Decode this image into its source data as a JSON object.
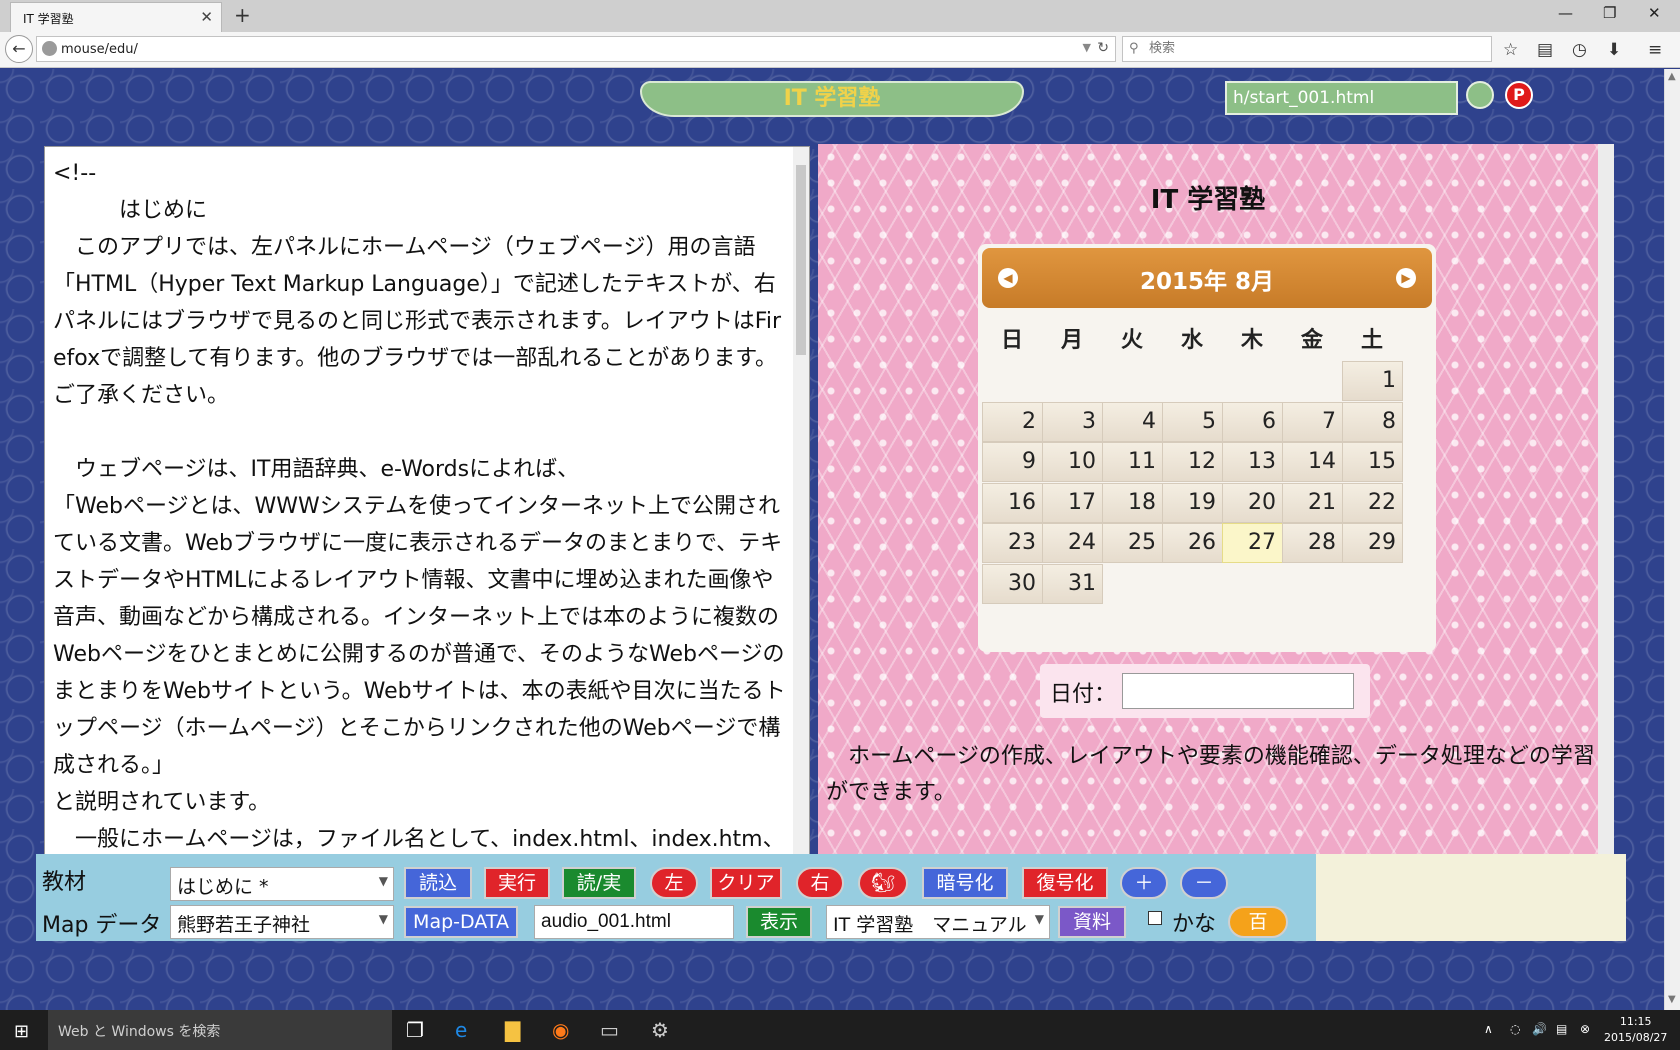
{
  "browser": {
    "tab_title": "IT 学習塾",
    "url": "mouse/edu/",
    "search_placeholder": "検索"
  },
  "header": {
    "title": "IT 学習塾",
    "file_value": "h/start_001.html",
    "p_button": "P"
  },
  "left_panel": {
    "text": "<!--\n　　　はじめに\n　このアプリでは、左パネルにホームページ（ウェブページ）用の言語「HTML（Hyper Text Markup Language）」で記述したテキストが、右パネルにはブラウザで見るのと同じ形式で表示されます。レイアウトはFirefoxで調整して有ります。他のブラウザでは一部乱れることがあります。ご了承ください。\n\n　ウェブページは、IT用語辞典、e-Wordsによれば、\n「Webページとは、WWWシステムを使ってインターネット上で公開されている文書。Webブラウザに一度に表示されるデータのまとまりで、テキストデータやHTMLによるレイアウト情報、文書中に埋め込まれた画像や音声、動画などから構成される。インターネット上では本のように複数のWebページをひとまとめに公開するのが普通で、そのようなWebページのまとまりをWebサイトという。Webサイトは、本の表紙や目次に当たるトップページ（ホームページ）とそこからリンクされた他のWebページで構成される。」\nと説明されています。\n　一般にホームページは，ファイル名として、index.html、index.htm、default.html などが用いられています。なお、本アプ"
  },
  "right_panel": {
    "title": "IT 学習塾",
    "calendar": {
      "title": "2015年 8月",
      "prev_icon": "prev-arrow",
      "next_icon": "next-arrow",
      "weekdays": [
        "日",
        "月",
        "火",
        "水",
        "木",
        "金",
        "土"
      ],
      "first_weekday_index": 6,
      "days": [
        "1",
        "2",
        "3",
        "4",
        "5",
        "6",
        "7",
        "8",
        "9",
        "10",
        "11",
        "12",
        "13",
        "14",
        "15",
        "16",
        "17",
        "18",
        "19",
        "20",
        "21",
        "22",
        "23",
        "24",
        "25",
        "26",
        "27",
        "28",
        "29",
        "30",
        "31"
      ],
      "today": "27"
    },
    "date_label": "日付：",
    "date_value": "",
    "description": "　ホームページの作成、レイアウトや要素の機能確認、データ処理などの学習ができます。"
  },
  "controls": {
    "row1": {
      "label": "教材",
      "select_value": "はじめに *",
      "buttons": {
        "load": "読込",
        "run": "実行",
        "load_run": "読/実",
        "left": "左",
        "clear": "クリア",
        "right": "右",
        "squirrel_icon": "squirrel-icon",
        "encrypt": "暗号化",
        "decrypt": "復号化",
        "plus": "＋",
        "minus": "－"
      }
    },
    "row2": {
      "label": "Map データ",
      "select_value": "熊野若王子神社",
      "map_data_button": "Map-DATA",
      "file_value": "audio_001.html",
      "show_button": "表示",
      "manual_select": "IT 学習塾　マニュアル",
      "docs_button": "資料",
      "kana_label": "かな",
      "hyaku_button": "百"
    }
  },
  "taskbar": {
    "search_placeholder": "Web と Windows を検索",
    "time": "11:15",
    "date": "2015/08/27"
  }
}
